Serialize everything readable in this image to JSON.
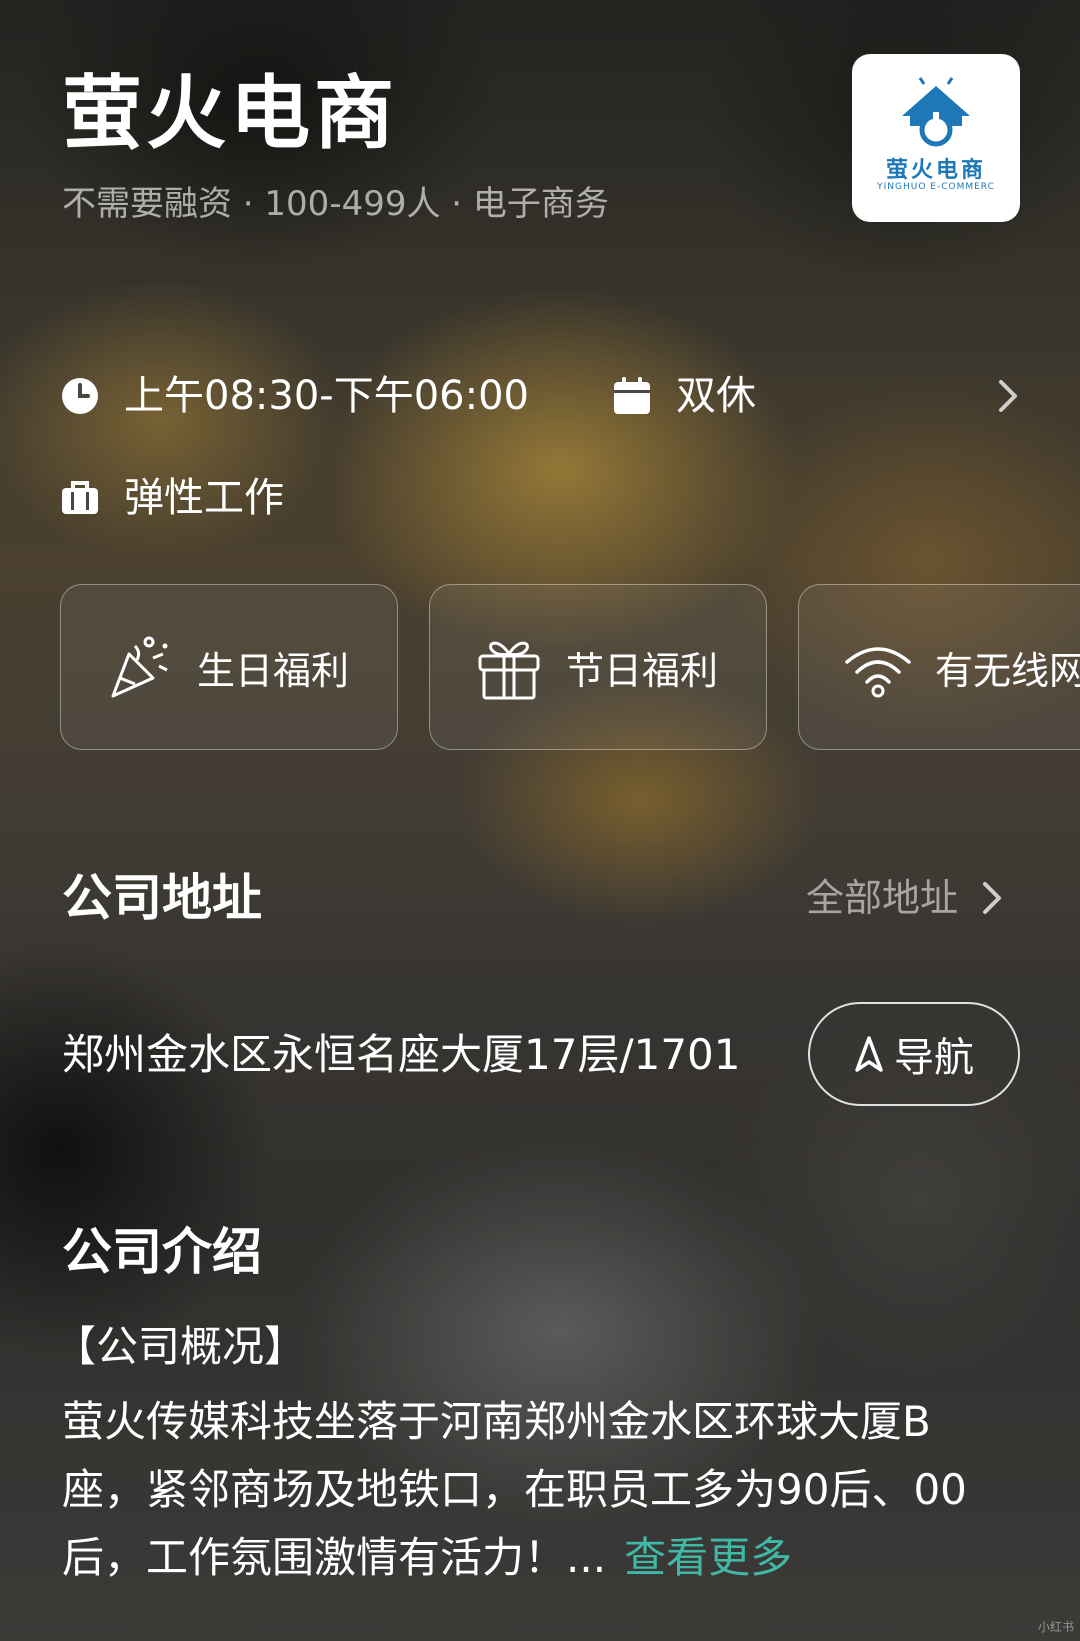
{
  "company": {
    "name": "萤火电商",
    "meta": "不需要融资 · 100-499人 · 电子商务",
    "logo": {
      "text": "萤火电商",
      "subtext": "YINGHUO E-COMMERC"
    }
  },
  "work_info": {
    "hours": "上午08:30-下午06:00",
    "rest": "双休",
    "work_type": "弹性工作"
  },
  "benefits": [
    {
      "label": "生日福利",
      "icon": "party-popper-icon"
    },
    {
      "label": "节日福利",
      "icon": "gift-icon"
    },
    {
      "label": "有无线网",
      "icon": "wifi-icon"
    }
  ],
  "address_section": {
    "title": "公司地址",
    "all_link": "全部地址",
    "address": "郑州金水区永恒名座大厦17层/1701",
    "nav_button": "导航"
  },
  "intro_section": {
    "title": "公司介绍",
    "heading": "【公司概况】",
    "body": "萤火传媒科技坐落于河南郑州金水区环球大厦B座，紧邻商场及地铁口，在职员工多为90后、00后，工作氛围激情有活力！...",
    "see_more": "查看更多"
  },
  "watermark": "小红书",
  "colors": {
    "accent": "#3fb8a6",
    "logo_blue": "#1e78b8"
  }
}
